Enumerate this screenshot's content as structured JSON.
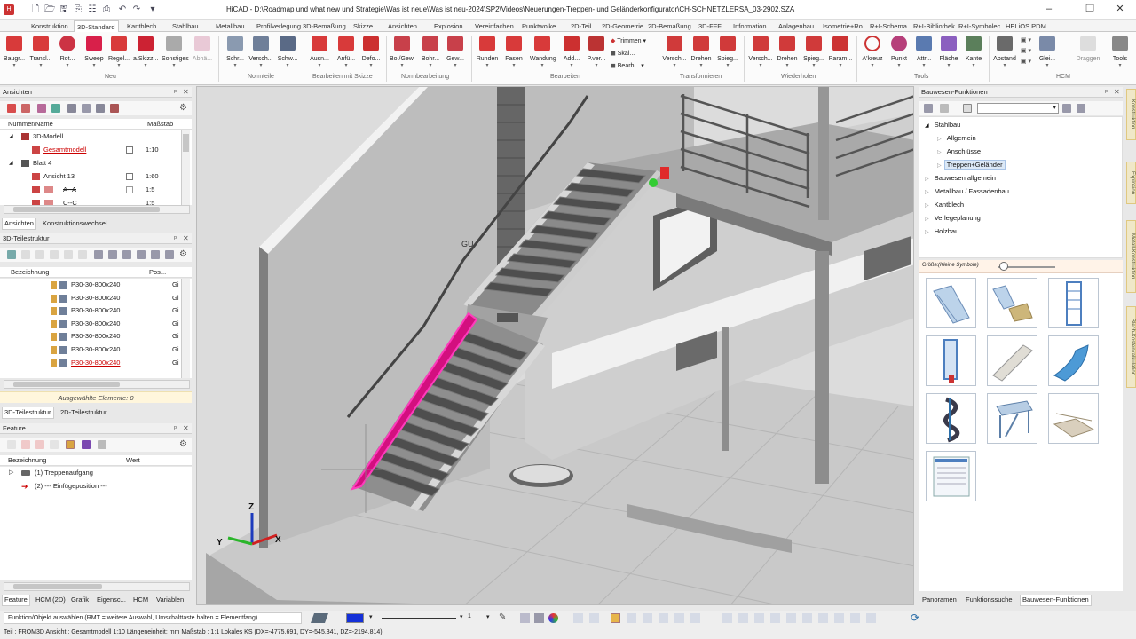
{
  "window": {
    "title": "HiCAD - D:\\Roadmap und what new und Strategie\\Was ist neue\\Was ist neu-2024\\SP2\\Videos\\Neuerungen-Treppen- und Geländerkonfigurator\\CH-SCHNETZLERSA_03-2902.SZA",
    "min": "–",
    "max": "❐",
    "close": "✕"
  },
  "tabs": [
    "Konstruktion",
    "3D-Standard",
    "Kantblech",
    "Stahlbau",
    "Metallbau",
    "Profilverlegung",
    "3D-Bemaßung",
    "Skizze",
    "Ansichten",
    "Explosion",
    "Vereinfachen",
    "Punktwolke",
    "2D-Teil",
    "2D-Geometrie",
    "2D-Bemaßung",
    "3D-FFF",
    "Information",
    "Anlagenbau",
    "Isometrie+Ro",
    "R+I-Schema",
    "R+I-Bibliothek",
    "R+I-Symbolec",
    "HELiOS PDM"
  ],
  "ribbon": {
    "buttons": [
      "Baugr...",
      "Transl...",
      "Rot...",
      "Sweep",
      "Regel...",
      "a.Skizz...",
      "Sonstiges",
      "Abhä...",
      "Schr...",
      "Versch...",
      "Schw...",
      "Ausn...",
      "Anfü...",
      "Defo...",
      "Bo./Gew.",
      "Bohr...",
      "Gew...",
      "Runden",
      "Fasen",
      "Wandung",
      "Add...",
      "P.ver...",
      "Versch...",
      "Drehen",
      "Spieg...",
      "Versch...",
      "Drehen",
      "Spieg...",
      "Param...",
      "A'kreuz",
      "Punkt",
      "Attr...",
      "Fläche",
      "Kante",
      "Abstand",
      "Glei...",
      "Draggen",
      "Tools"
    ],
    "small_buttons": [
      "Trimmen",
      "Skal...",
      "Bearb..."
    ],
    "groups": [
      "Neu",
      "Normteile",
      "Bearbeiten mit Skizze",
      "Normbearbeitung",
      "Bearbeiten",
      "Transformieren",
      "Wiederholen",
      "Tools",
      "HCM"
    ]
  },
  "ansichten": {
    "title": "Ansichten",
    "columns": [
      "Nummer/Name",
      "Maßstab"
    ],
    "rows": [
      {
        "name": "3D-Modell",
        "scale": ""
      },
      {
        "name": "Gesamtmodell",
        "scale": "1:10"
      },
      {
        "name": "Blatt 4",
        "scale": ""
      },
      {
        "name": "Ansicht 13",
        "scale": "1:60"
      },
      {
        "name": "A--A",
        "scale": "1:5"
      },
      {
        "name": "C--C",
        "scale": "1:5"
      }
    ],
    "tabs": [
      "Ansichten",
      "Konstruktionswechsel"
    ]
  },
  "teilestruktur": {
    "title": "3D-Teilestruktur",
    "columns": [
      "Bezeichnung",
      "Pos..."
    ],
    "rows": [
      "P30-30-800x240",
      "P30-30-800x240",
      "P30-30-800x240",
      "P30-30-800x240",
      "P30-30-800x240",
      "P30-30-800x240",
      "P30-30-800x240"
    ],
    "pos": "Gi",
    "selected": "Ausgewählte Elemente: 0",
    "tabs": [
      "3D-Teilestruktur",
      "2D-Teilestruktur"
    ]
  },
  "feature": {
    "title": "Feature",
    "columns": [
      "Bezeichnung",
      "Wert"
    ],
    "rows": [
      "(1) Treppenaufgang",
      "(2) --- Einfügeposition ---"
    ],
    "tabs": [
      "Feature",
      "HCM (2D)",
      "Grafik",
      "Eigensc...",
      "HCM",
      "Variablen"
    ]
  },
  "bauwesen": {
    "title": "Bauwesen-Funktionen",
    "tree": [
      "Stahlbau",
      "Allgemein",
      "Anschlüsse",
      "Treppen+Geländer",
      "Bauwesen allgemein",
      "Metallbau / Fassadenbau",
      "Kantblech",
      "Verlegeplanung",
      "Holzbau"
    ],
    "size_label": "Größe:",
    "size_value": "(Kleine Symbole)",
    "tabs": [
      "Panoramen",
      "Funktionssuche",
      "Bauwesen-Funktionen"
    ]
  },
  "right_tabs": [
    "Konstruktion",
    "Explosion",
    "Metall-Konstruktion",
    "Blech-Kostenkalkulation"
  ],
  "viewport": {
    "axis_x": "X",
    "axis_y": "Y",
    "axis_z": "Z",
    "model_label": "GU"
  },
  "status": {
    "prompt": "Funktion/Objekt auswählen (RMT = weitere Auswahl, Umschalttaste halten = Elementfang)",
    "line_width": "1",
    "info": "Teil : FROM3D   Ansicht : Gesamtmodell 1:10  Längeneinheit: mm   Maßstab : 1:1   Lokales KS  (DX=-4775.691, DY=-545.341, DZ=-2194.814)"
  },
  "colors": {
    "accent": "#d30f7f",
    "selection": "#ff3cbd",
    "ribbon_red": "#d83a3a",
    "tab_active_bg": "#ffffff"
  }
}
